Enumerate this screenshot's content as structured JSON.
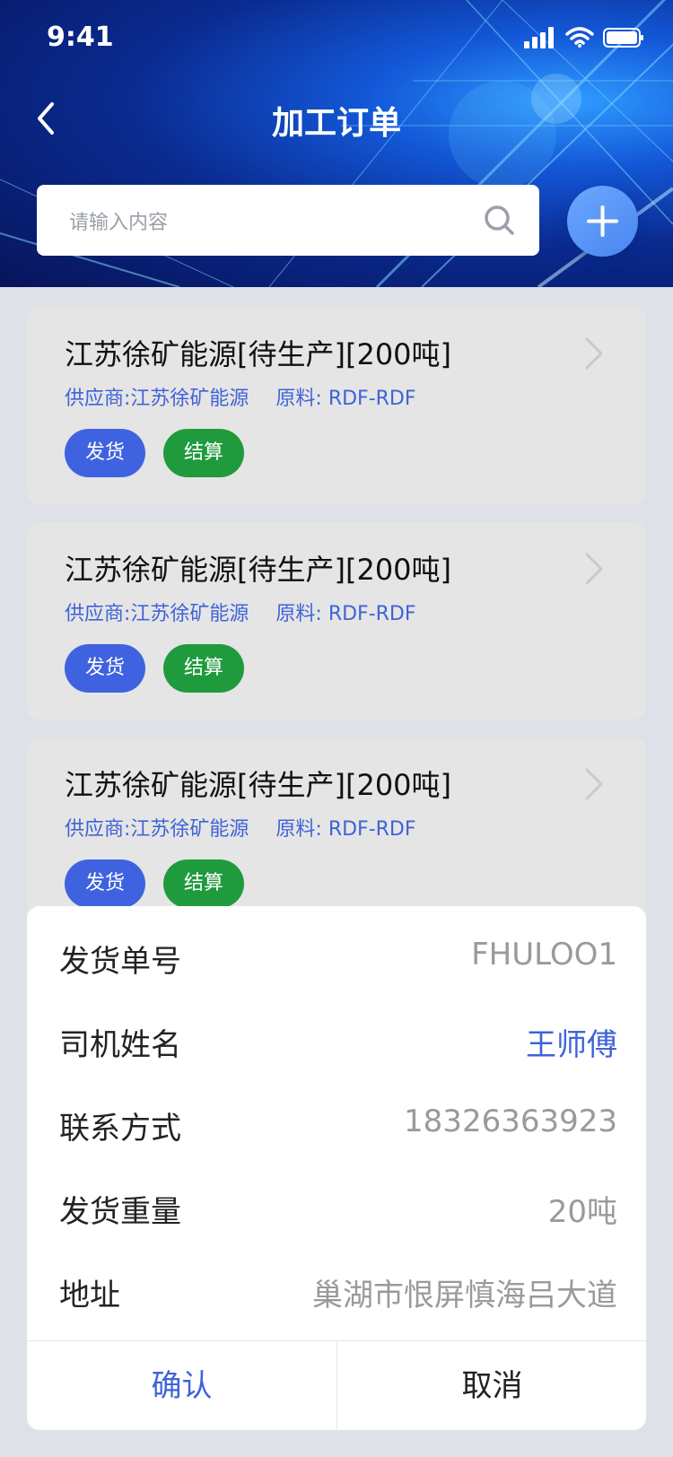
{
  "status": {
    "time": "9:41"
  },
  "nav": {
    "title": "加工订单"
  },
  "search": {
    "placeholder": "请输入内容"
  },
  "orders": [
    {
      "title": "江苏徐矿能源[待生产][200吨]",
      "supplier": "供应商:江苏徐矿能源",
      "material": "原料: RDF-RDF",
      "ship_label": "发货",
      "settle_label": "结算"
    },
    {
      "title": "江苏徐矿能源[待生产][200吨]",
      "supplier": "供应商:江苏徐矿能源",
      "material": "原料: RDF-RDF",
      "ship_label": "发货",
      "settle_label": "结算"
    },
    {
      "title": "江苏徐矿能源[待生产][200吨]",
      "supplier": "供应商:江苏徐矿能源",
      "material": "原料: RDF-RDF",
      "ship_label": "发货",
      "settle_label": "结算"
    }
  ],
  "sheet": {
    "rows": [
      {
        "label": "发货单号",
        "value": "FHULOO1"
      },
      {
        "label": "司机姓名",
        "value": "王师傅"
      },
      {
        "label": "联系方式",
        "value": "18326363923"
      },
      {
        "label": "发货重量",
        "value": "20吨"
      },
      {
        "label": "地址",
        "value": "巢湖市恨屏慎海吕大道"
      }
    ],
    "confirm_label": "确认",
    "cancel_label": "取消"
  },
  "colors": {
    "accent": "#3f63d8",
    "settle": "#1f9b3d",
    "ship": "#3f63e0"
  }
}
